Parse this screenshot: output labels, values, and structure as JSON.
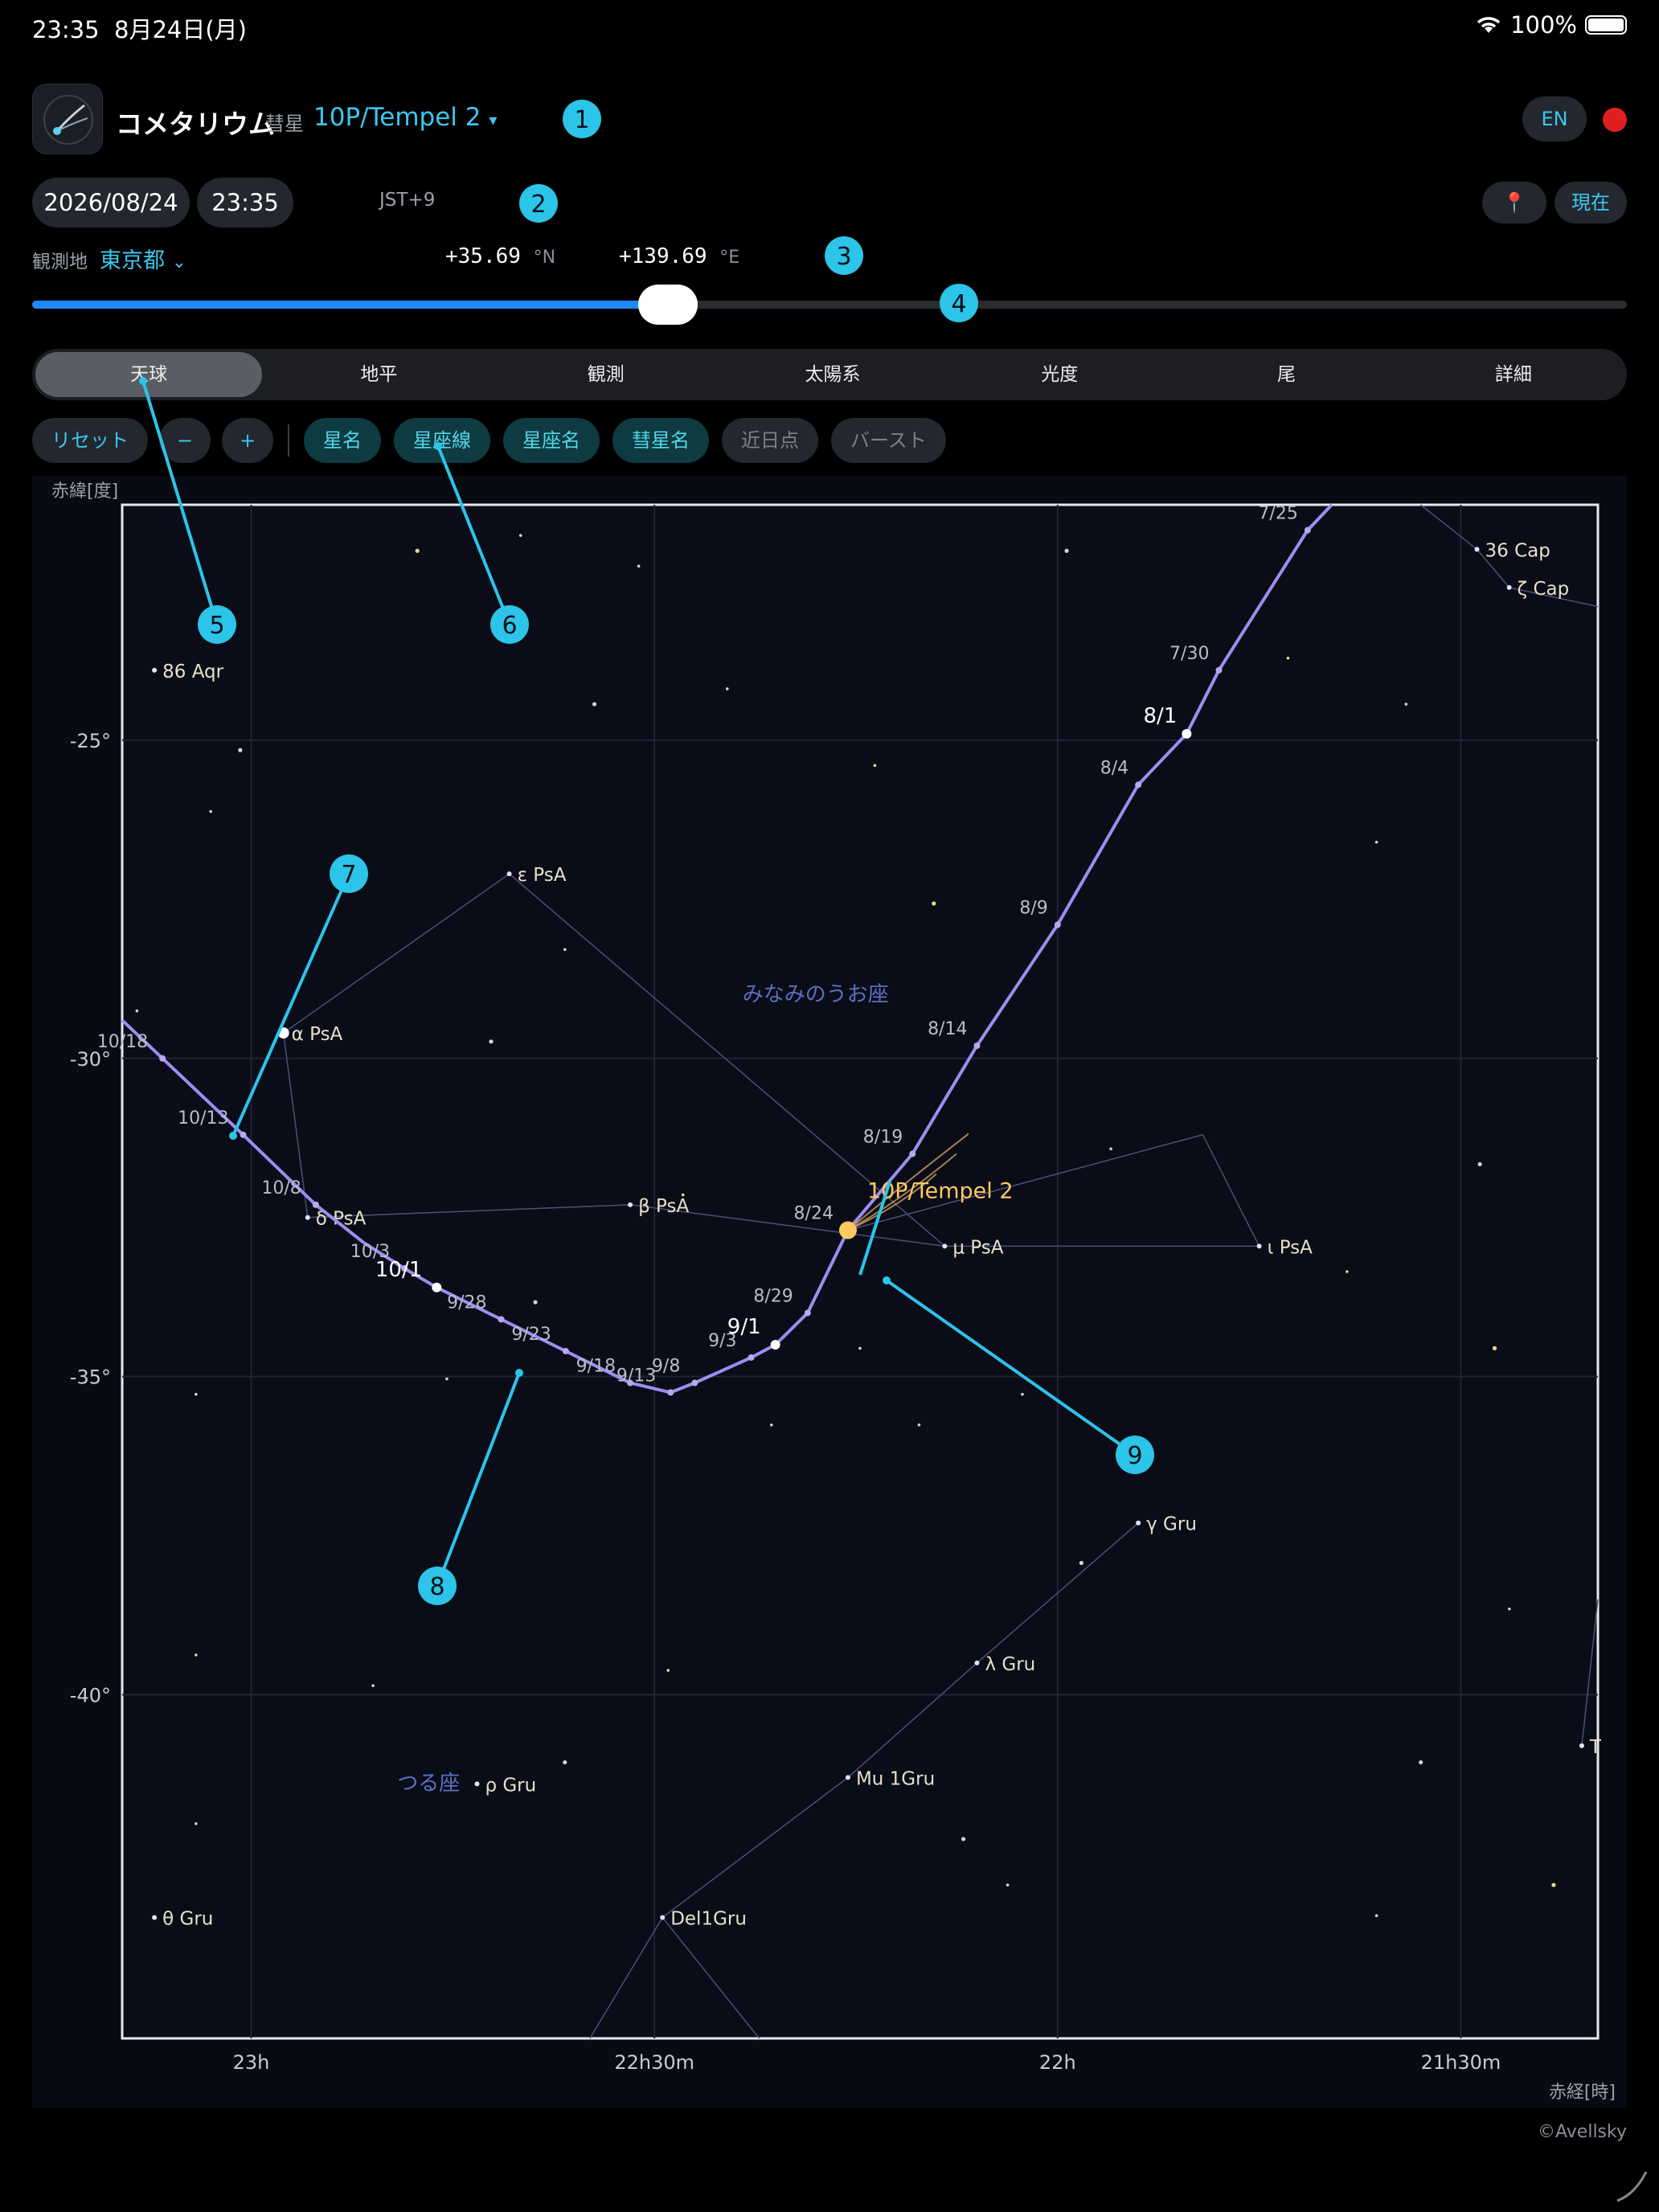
{
  "status_bar": {
    "time": "23:35",
    "date": "8月24日(月)",
    "battery": "100%"
  },
  "header": {
    "app_name": "コメタリウム",
    "object_kind": "彗星",
    "comet_name": "10P/Tempel 2",
    "dropdown_arrow": "▾",
    "lang_button": "EN"
  },
  "datetime": {
    "date": "2026/08/24",
    "time": "23:35",
    "timezone": "JST+9",
    "location_button_icon": "📍",
    "now_button": "現在"
  },
  "observer": {
    "label": "観測地",
    "location": "東京都",
    "chevron": "⌄",
    "lat_value": "+35.69",
    "lat_unit": "°N",
    "lon_value": "+139.69",
    "lon_unit": "°E"
  },
  "slider": {
    "position": 0.38
  },
  "tabs": [
    {
      "label": "天球",
      "active": true
    },
    {
      "label": "地平"
    },
    {
      "label": "観測"
    },
    {
      "label": "太陽系"
    },
    {
      "label": "光度"
    },
    {
      "label": "尾"
    },
    {
      "label": "詳細"
    }
  ],
  "toolbar": {
    "reset": "リセット",
    "minus": "−",
    "plus": "+",
    "toggles": [
      {
        "label": "星名",
        "on": true
      },
      {
        "label": "星座線",
        "on": true
      },
      {
        "label": "星座名",
        "on": true
      },
      {
        "label": "彗星名",
        "on": true
      },
      {
        "label": "近日点",
        "on": false
      },
      {
        "label": "バースト",
        "on": false
      }
    ]
  },
  "callouts": [
    "1",
    "2",
    "3",
    "4",
    "5",
    "6",
    "7",
    "8",
    "9"
  ],
  "credit": "©Avellsky",
  "colors": {
    "accent": "#3ac8f0",
    "path": "#a08cf0",
    "comet": "#ffc860",
    "callout": "#2cc4e8"
  },
  "chart_data": {
    "type": "scatter",
    "ylabel": "赤緯[度]",
    "xlabel": "赤経[時]",
    "x_axis": "RA (hours, decreasing to the right)",
    "xlim": [
      23.16,
      21.33
    ],
    "ylim": [
      -45.4,
      -21.3
    ],
    "x_ticks": [
      {
        "value": 23.0,
        "label": "23h"
      },
      {
        "value": 22.5,
        "label": "22h30m"
      },
      {
        "value": 22.0,
        "label": "22h"
      },
      {
        "value": 21.5,
        "label": "21h30m"
      }
    ],
    "y_ticks": [
      {
        "value": -25,
        "label": "-25°"
      },
      {
        "value": -30,
        "label": "-30°"
      },
      {
        "value": -35,
        "label": "-35°"
      },
      {
        "value": -40,
        "label": "-40°"
      }
    ],
    "grid": true,
    "comet": {
      "name": "10P/Tempel 2",
      "ra": 22.26,
      "dec": -32.7
    },
    "path": [
      {
        "ra": 23.16,
        "dec": -29.4,
        "label": ""
      },
      {
        "ra": 23.11,
        "dec": -30.0,
        "label": "10/18"
      },
      {
        "ra": 23.01,
        "dec": -31.2,
        "label": "10/13"
      },
      {
        "ra": 22.92,
        "dec": -32.3,
        "label": "10/8"
      },
      {
        "ra": 22.86,
        "dec": -32.9,
        "label": ""
      },
      {
        "ra": 22.81,
        "dec": -33.3,
        "label": "10/3"
      },
      {
        "ra": 22.77,
        "dec": -33.6,
        "label": "10/1",
        "major": true
      },
      {
        "ra": 22.69,
        "dec": -34.1,
        "label": "9/28"
      },
      {
        "ra": 22.61,
        "dec": -34.6,
        "label": "9/23"
      },
      {
        "ra": 22.53,
        "dec": -35.1,
        "label": "9/18"
      },
      {
        "ra": 22.48,
        "dec": -35.25,
        "label": "9/13"
      },
      {
        "ra": 22.45,
        "dec": -35.1,
        "label": "9/8"
      },
      {
        "ra": 22.38,
        "dec": -34.7,
        "label": "9/3"
      },
      {
        "ra": 22.35,
        "dec": -34.5,
        "label": "9/1",
        "major": true
      },
      {
        "ra": 22.31,
        "dec": -34.0,
        "label": "8/29"
      },
      {
        "ra": 22.26,
        "dec": -32.7,
        "label": "8/24"
      },
      {
        "ra": 22.18,
        "dec": -31.5,
        "label": "8/19"
      },
      {
        "ra": 22.1,
        "dec": -29.8,
        "label": "8/14"
      },
      {
        "ra": 22.0,
        "dec": -27.9,
        "label": "8/9"
      },
      {
        "ra": 21.9,
        "dec": -25.7,
        "label": "8/4"
      },
      {
        "ra": 21.84,
        "dec": -24.9,
        "label": "8/1",
        "major": true
      },
      {
        "ra": 21.8,
        "dec": -23.9,
        "label": "7/30"
      },
      {
        "ra": 21.69,
        "dec": -21.7,
        "label": "7/25"
      },
      {
        "ra": 21.66,
        "dec": -21.3,
        "label": ""
      }
    ],
    "stars": [
      {
        "name": "86 Aqr",
        "ra": 23.12,
        "dec": -23.9
      },
      {
        "name": "36 Cap",
        "ra": 21.48,
        "dec": -22.0
      },
      {
        "name": "ζ Cap",
        "ra": 21.44,
        "dec": -22.6
      },
      {
        "name": "ε PsA",
        "ra": 22.68,
        "dec": -27.1
      },
      {
        "name": "α PsA",
        "ra": 22.96,
        "dec": -29.6
      },
      {
        "name": "δ PsA",
        "ra": 22.93,
        "dec": -32.5
      },
      {
        "name": "β PsA",
        "ra": 22.53,
        "dec": -32.3
      },
      {
        "name": "μ PsA",
        "ra": 22.14,
        "dec": -32.95
      },
      {
        "name": "ι PsA",
        "ra": 21.75,
        "dec": -32.95
      },
      {
        "name": "γ Gru",
        "ra": 21.9,
        "dec": -37.3
      },
      {
        "name": "λ Gru",
        "ra": 22.1,
        "dec": -39.5
      },
      {
        "name": "Mu 1Gru",
        "ra": 22.26,
        "dec": -41.3
      },
      {
        "name": "Del1Gru",
        "ra": 22.49,
        "dec": -43.5
      },
      {
        "name": "ρ Gru",
        "ra": 22.72,
        "dec": -41.4
      },
      {
        "name": "θ Gru",
        "ra": 23.12,
        "dec": -43.5
      },
      {
        "name": "T",
        "ra": 21.35,
        "dec": -40.8
      }
    ],
    "constellations": [
      {
        "name": "みなみのうお座",
        "ra": 22.3,
        "dec": -29.1
      },
      {
        "name": "つる座",
        "ra": 22.78,
        "dec": -41.5
      }
    ]
  }
}
